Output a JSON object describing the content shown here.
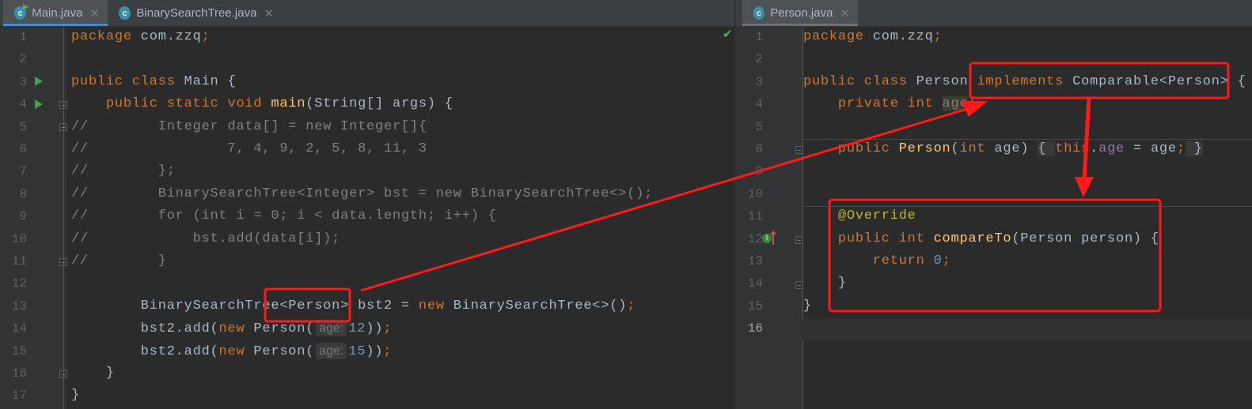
{
  "colors": {
    "background": "#2b2b2b",
    "keyword": "#cc7832",
    "text": "#a9b7c6",
    "number": "#6897bb",
    "comment": "#808080",
    "annotation": "#bbb529",
    "method": "#ffc66d",
    "field": "#9876aa",
    "highlight_red": "#ff1a1a",
    "tab_accent": "#4a88c7"
  },
  "left_editor": {
    "tabs": [
      {
        "label": "Main.java",
        "icon": "java-class-runnable-icon",
        "active": true
      },
      {
        "label": "BinarySearchTree.java",
        "icon": "java-class-icon",
        "active": false
      }
    ],
    "class_icon_letter": "c",
    "inspection_status_icon": "checkmark-icon",
    "lines": [
      {
        "n": "1",
        "t": [
          [
            "package ",
            "kw"
          ],
          [
            "com.zzq",
            "tx"
          ],
          [
            ";",
            "kw"
          ]
        ]
      },
      {
        "n": "2",
        "t": []
      },
      {
        "n": "3",
        "t": [
          [
            "public class ",
            "kw"
          ],
          [
            "Main {",
            "tx"
          ]
        ]
      },
      {
        "n": "4",
        "t": [
          [
            "    public static void ",
            "kw"
          ],
          [
            "main",
            "fn"
          ],
          [
            "(String[] args) {",
            "tx"
          ]
        ]
      },
      {
        "n": "5",
        "t": [
          [
            "//        Integer data[] = new Integer[]{",
            "cm"
          ]
        ]
      },
      {
        "n": "6",
        "t": [
          [
            "//                7, 4, 9, 2, 5, 8, 11, 3",
            "cm"
          ]
        ]
      },
      {
        "n": "7",
        "t": [
          [
            "//        };",
            "cm"
          ]
        ]
      },
      {
        "n": "8",
        "t": [
          [
            "//        BinarySearchTree<Integer> bst = new BinarySearchTree<>();",
            "cm"
          ]
        ]
      },
      {
        "n": "9",
        "t": [
          [
            "//        for (int i = 0; i < data.length; i++) {",
            "cm"
          ]
        ]
      },
      {
        "n": "10",
        "t": [
          [
            "//            bst.add(data[i]);",
            "cm"
          ]
        ]
      },
      {
        "n": "11",
        "t": [
          [
            "//        }",
            "cm"
          ]
        ]
      },
      {
        "n": "12",
        "t": []
      },
      {
        "n": "13",
        "t": [
          [
            "        BinarySearchTree<Person> bst2 = ",
            "tx"
          ],
          [
            "new ",
            "kw"
          ],
          [
            "BinarySearchTree<>()",
            "tx"
          ],
          [
            ";",
            "kw"
          ]
        ]
      },
      {
        "n": "14",
        "t": [
          [
            "        bst2.add(",
            "tx"
          ],
          [
            "new ",
            "kw"
          ],
          [
            "Person(",
            "tx"
          ],
          [
            "age:",
            "hint"
          ],
          [
            "12",
            "num"
          ],
          [
            "))",
            "tx"
          ],
          [
            ";",
            "kw"
          ]
        ]
      },
      {
        "n": "15",
        "t": [
          [
            "        bst2.add(",
            "tx"
          ],
          [
            "new ",
            "kw"
          ],
          [
            "Person(",
            "tx"
          ],
          [
            "age:",
            "hint"
          ],
          [
            "15",
            "num"
          ],
          [
            "))",
            "tx"
          ],
          [
            ";",
            "kw"
          ]
        ]
      },
      {
        "n": "16",
        "t": [
          [
            "    }",
            "tx"
          ]
        ]
      },
      {
        "n": "17",
        "t": [
          [
            "}",
            "tx"
          ]
        ]
      }
    ]
  },
  "right_editor": {
    "tabs": [
      {
        "label": "Person.java",
        "icon": "java-class-icon",
        "active": true
      }
    ],
    "class_icon_letter": "c",
    "implements_marker_letter": "I",
    "current_line": "16",
    "lines": [
      {
        "n": "1",
        "t": [
          [
            "package ",
            "kw"
          ],
          [
            "com.zzq",
            "tx"
          ],
          [
            ";",
            "kw"
          ]
        ]
      },
      {
        "n": "2",
        "t": []
      },
      {
        "n": "3",
        "t": [
          [
            "public class ",
            "kw"
          ],
          [
            "Person ",
            "tx"
          ],
          [
            "implements ",
            "kw"
          ],
          [
            "Comparable<Person> {",
            "tx"
          ]
        ]
      },
      {
        "n": "4",
        "t": [
          [
            "    private int ",
            "kw"
          ],
          [
            "age",
            "hl"
          ],
          [
            ";",
            "kw"
          ]
        ]
      },
      {
        "n": "5",
        "t": []
      },
      {
        "n": "6",
        "t": [
          [
            "    public ",
            "kw"
          ],
          [
            "Person",
            "fn"
          ],
          [
            "(",
            "tx"
          ],
          [
            "int ",
            "kw"
          ],
          [
            "age) ",
            "tx"
          ],
          [
            "{ ",
            "fold"
          ],
          [
            "this",
            "kw"
          ],
          [
            ".",
            "tx"
          ],
          [
            "age",
            "fld"
          ],
          [
            " = age",
            "tx"
          ],
          [
            ";",
            "kw"
          ],
          [
            " }",
            "fold"
          ]
        ]
      },
      {
        "n": "9",
        "t": []
      },
      {
        "n": "10",
        "t": []
      },
      {
        "n": "11",
        "t": [
          [
            "    @Override",
            "ann"
          ]
        ]
      },
      {
        "n": "12",
        "t": [
          [
            "    public int ",
            "kw"
          ],
          [
            "compareTo",
            "fn"
          ],
          [
            "(Person person) {",
            "tx"
          ]
        ]
      },
      {
        "n": "13",
        "t": [
          [
            "        return ",
            "kw"
          ],
          [
            "0",
            "num"
          ],
          [
            ";",
            "kw"
          ]
        ]
      },
      {
        "n": "14",
        "t": [
          [
            "    }",
            "tx"
          ]
        ]
      },
      {
        "n": "15",
        "t": [
          [
            "}",
            "tx"
          ]
        ]
      },
      {
        "n": "16",
        "t": []
      }
    ]
  }
}
